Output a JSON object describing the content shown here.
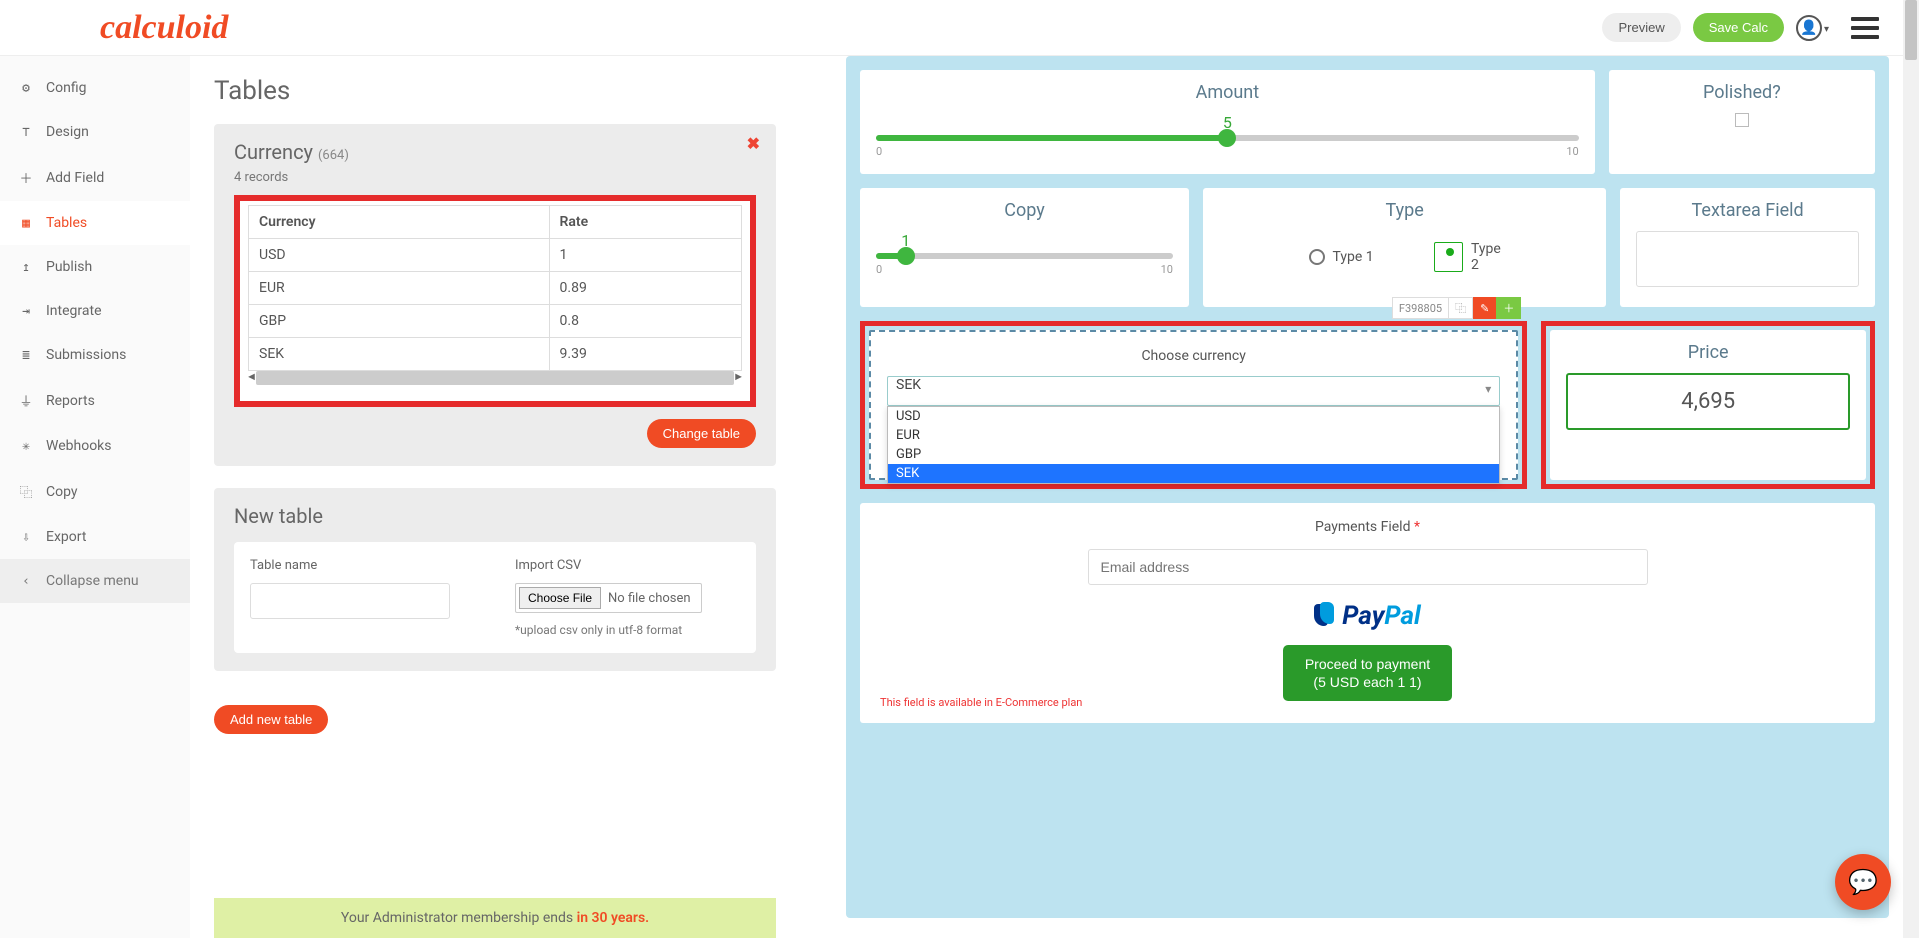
{
  "topbar": {
    "logo": "calculoid",
    "preview": "Preview",
    "save": "Save Calc"
  },
  "sidebar": {
    "items": [
      {
        "icon": "⚙",
        "label": "Config"
      },
      {
        "icon": "⊤",
        "label": "Design"
      },
      {
        "icon": "＋",
        "label": "Add Field"
      },
      {
        "icon": "▦",
        "label": "Tables"
      },
      {
        "icon": "↥",
        "label": "Publish"
      },
      {
        "icon": "⇥",
        "label": "Integrate"
      },
      {
        "icon": "≣",
        "label": "Submissions"
      },
      {
        "icon": "⏚",
        "label": "Reports"
      },
      {
        "icon": "✳",
        "label": "Webhooks"
      },
      {
        "icon": "⿻",
        "label": "Copy"
      },
      {
        "icon": "⇩",
        "label": "Export"
      }
    ],
    "collapse": {
      "icon": "‹",
      "label": "Collapse menu"
    }
  },
  "panel": {
    "heading": "Tables",
    "currency": {
      "title": "Currency",
      "count": "(664)",
      "records": "4 records",
      "headers": [
        "Currency",
        "Rate"
      ],
      "rows": [
        {
          "idx": "0",
          "c": "USD",
          "r": "1"
        },
        {
          "idx": "1",
          "c": "EUR",
          "r": "0.89"
        },
        {
          "idx": "2",
          "c": "GBP",
          "r": "0.8"
        },
        {
          "idx": "3",
          "c": "SEK",
          "r": "9.39"
        }
      ],
      "change": "Change table"
    },
    "newTable": {
      "title": "New table",
      "nameLabel": "Table name",
      "importLabel": "Import CSV",
      "choose": "Choose File",
      "nofile": "No file chosen",
      "hint": "*upload csv only in utf-8 format",
      "add": "Add new table"
    },
    "footer": {
      "t1": "Your Administrator membership ends ",
      "t2": "in 30 years."
    }
  },
  "calc": {
    "amount": {
      "title": "Amount",
      "value": "5",
      "min": "0",
      "max": "10",
      "pct": 50
    },
    "polished": {
      "title": "Polished?"
    },
    "copy": {
      "title": "Copy",
      "value": "1",
      "min": "0",
      "max": "10",
      "pct": 10
    },
    "type": {
      "title": "Type",
      "opt1": "Type 1",
      "opt2": "Type 2"
    },
    "textarea": {
      "title": "Textarea Field"
    },
    "fieldId": "F398805",
    "currency": {
      "title": "Choose currency",
      "selected": "SEK",
      "options": [
        "USD",
        "EUR",
        "GBP",
        "SEK"
      ]
    },
    "price": {
      "title": "Price",
      "value": "4,695"
    },
    "payments": {
      "title": "Payments Field ",
      "placeholder": "Email address",
      "proceed1": "Proceed to payment",
      "proceed2": "(5 USD each 1 1)",
      "note": "This field is available in E-Commerce plan"
    }
  }
}
